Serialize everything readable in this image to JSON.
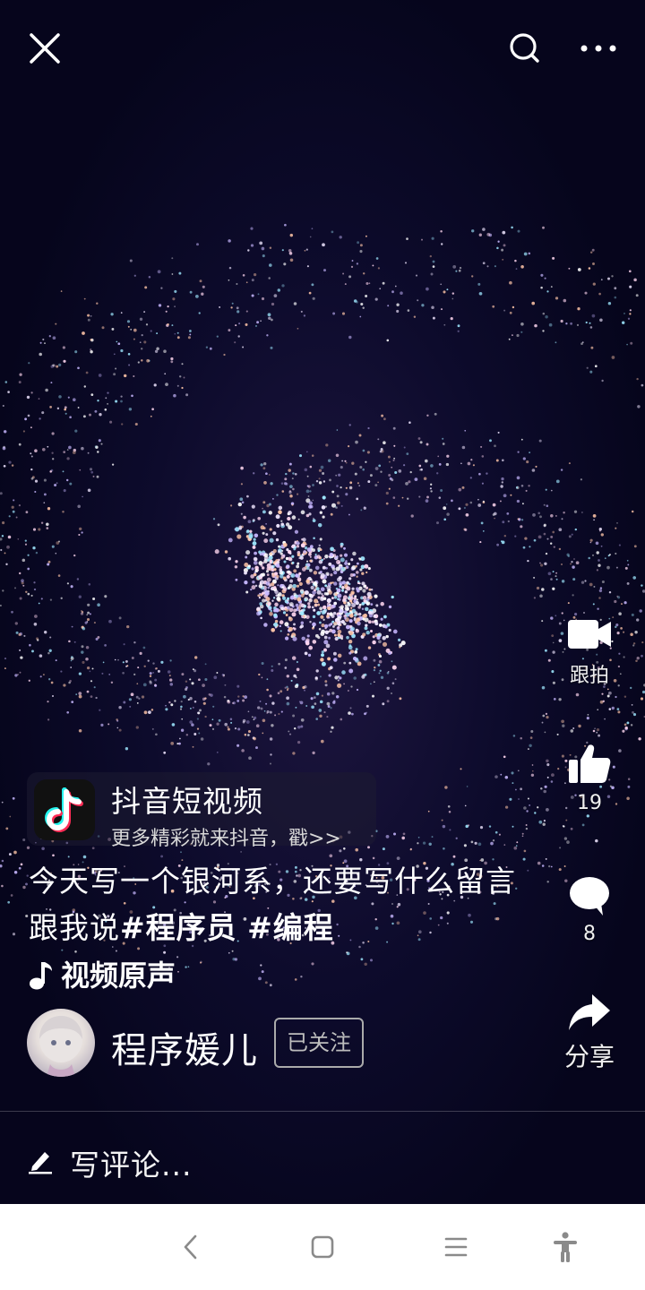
{
  "topbar": {
    "close_icon": "close-icon",
    "search_icon": "search-icon",
    "more_icon": "more-icon"
  },
  "side_actions": {
    "duet": {
      "icon": "video-camera-icon",
      "label": "跟拍"
    },
    "like": {
      "icon": "thumbs-up-icon",
      "count": "19"
    },
    "comment": {
      "icon": "comment-bubble-icon",
      "count": "8"
    },
    "share": {
      "icon": "share-arrow-icon",
      "label": "分享"
    }
  },
  "promo": {
    "title": "抖音短视频",
    "subtitle": "更多精彩就来抖音，戳>>"
  },
  "caption": {
    "text": "今天写一个银河系，还要写什么留言跟我说",
    "tags": [
      "#程序员",
      "#编程"
    ]
  },
  "music": {
    "icon": "music-note-icon",
    "label": "视频原声"
  },
  "author": {
    "name": "程序媛儿",
    "follow_status": "已关注"
  },
  "comment_input": {
    "placeholder": "写评论..."
  },
  "navbar": {
    "back_icon": "back-icon",
    "home_icon": "home-icon",
    "menu_icon": "menu-icon",
    "accessibility_icon": "accessibility-icon"
  },
  "colors": {
    "background": "#07061f",
    "navbar": "#ffffff",
    "text": "#ffffff"
  }
}
